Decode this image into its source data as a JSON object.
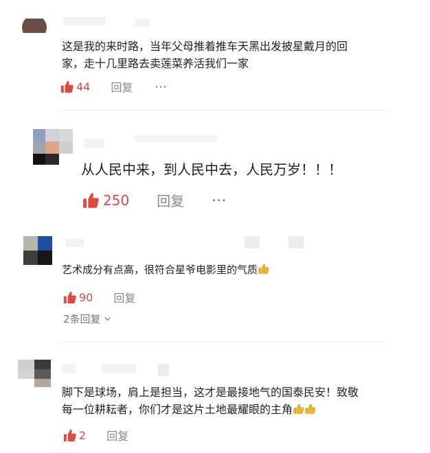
{
  "comments": [
    {
      "text_lines": [
        "这是我的来时路，当年父母推着推车天黑出发披星戴月的回",
        "家，走十几里路去卖莲菜养活我们一家"
      ],
      "likes": "44",
      "reply_label": "回复",
      "more_label": "···"
    },
    {
      "text_lines": [
        "从人民中来，到人民中去，人民万岁！！！"
      ],
      "likes": "250",
      "reply_label": "回复",
      "more_label": "···"
    },
    {
      "text_lines": [
        "艺术成分有点高，很符合星爷电影里的气质"
      ],
      "likes": "90",
      "reply_label": "回复",
      "sub_replies_label": "2条回复"
    },
    {
      "text_lines": [
        "脚下是球场，肩上是担当，这才是最接地气的国泰民安！致敬",
        "每一位耕耘者，你们才是这片土地最耀眼的主角"
      ],
      "likes": "2",
      "reply_label": "回复"
    }
  ],
  "colors": {
    "like_red": "#e5473c",
    "reply_gray": "#888888",
    "emoji_yellow": "#f5b51f"
  },
  "icons": {
    "like": "thumbs-up-icon",
    "more": "more-dots-icon",
    "expand": "chevron-down-icon",
    "emoji": "thumbs-up-emoji"
  }
}
